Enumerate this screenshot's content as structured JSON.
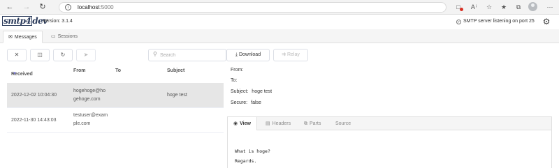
{
  "browser": {
    "url_host": "localhost",
    "url_port": ":5000"
  },
  "app": {
    "logo": {
      "part1": "smtp",
      "part2": "4",
      "part3": "dev"
    },
    "version": "Version: 3.1.4",
    "status": "SMTP server listening on port 25"
  },
  "tabs": [
    {
      "label": "Messages",
      "icon": "envelope-icon"
    },
    {
      "label": "Sessions",
      "icon": "monitor-icon"
    }
  ],
  "toolbar": {
    "search_placeholder": "Search",
    "download_label": "Download",
    "relay_label": "Relay"
  },
  "list": {
    "columns": {
      "received": "Received",
      "from": "From",
      "to": "To",
      "subject": "Subject"
    },
    "rows": [
      {
        "received": "2022-12-02 10:04:30",
        "from_line1": "hogehoge@ho",
        "from_line2": "gehoge.com",
        "to": "",
        "subject": "hoge test",
        "selected": true
      },
      {
        "received": "2022-11-30 14:43:03",
        "from_line1": "testuser@exam",
        "from_line2": "ple.com",
        "to": "",
        "subject": "",
        "selected": false
      }
    ]
  },
  "detail": {
    "from_label": "From:",
    "from_value": "",
    "to_label": "To:",
    "to_value": "",
    "subject_label": "Subject:",
    "subject_value": "hoge test",
    "secure_label": "Secure:",
    "secure_value": "false",
    "tabs": [
      {
        "label": "View",
        "icon": "eye-icon"
      },
      {
        "label": "Headers",
        "icon": "document-icon"
      },
      {
        "label": "Parts",
        "icon": "copy-icon"
      },
      {
        "label": "Source",
        "icon": ""
      }
    ],
    "body_lines": [
      "What is hoge?",
      "Regards."
    ]
  },
  "colors": {
    "accent": "#6d6dcc",
    "selected_row": "#e6e6e6",
    "blocked": "#d93025"
  }
}
